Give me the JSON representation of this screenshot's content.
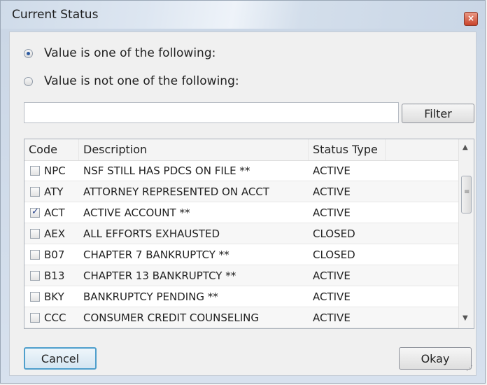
{
  "dialog": {
    "title": "Current Status",
    "close_glyph": "×"
  },
  "options": {
    "is_one_of": "Value is one of the following:",
    "is_not_one_of": "Value is not one of the following:",
    "selected": "is_one_of"
  },
  "filter": {
    "value": "",
    "button_label": "Filter"
  },
  "table": {
    "columns": [
      "Code",
      "Description",
      "Status Type"
    ],
    "rows": [
      {
        "checked": false,
        "code": "NPC",
        "description": "NSF STILL HAS PDCS ON FILE **",
        "status": "ACTIVE"
      },
      {
        "checked": false,
        "code": "ATY",
        "description": "ATTORNEY REPRESENTED ON ACCT",
        "status": "ACTIVE"
      },
      {
        "checked": true,
        "code": "ACT",
        "description": "ACTIVE ACCOUNT **",
        "status": "ACTIVE"
      },
      {
        "checked": false,
        "code": "AEX",
        "description": "ALL EFFORTS EXHAUSTED",
        "status": "CLOSED"
      },
      {
        "checked": false,
        "code": "B07",
        "description": "CHAPTER 7 BANKRUPTCY **",
        "status": "CLOSED"
      },
      {
        "checked": false,
        "code": "B13",
        "description": "CHAPTER 13 BANKRUPTCY **",
        "status": "ACTIVE"
      },
      {
        "checked": false,
        "code": "BKY",
        "description": "BANKRUPTCY PENDING **",
        "status": "ACTIVE"
      },
      {
        "checked": false,
        "code": "CCC",
        "description": "CONSUMER CREDIT COUNSELING",
        "status": "ACTIVE"
      }
    ]
  },
  "buttons": {
    "cancel": "Cancel",
    "okay": "Okay"
  },
  "icons": {
    "close": "close-icon",
    "scroll_up": "chevron-up-icon",
    "scroll_down": "chevron-down-icon",
    "size_grip": "size-grip-icon"
  },
  "colors": {
    "accent_focus": "#4f9fcc",
    "close_button": "#c9432a",
    "check_mark": "#233f8a"
  }
}
